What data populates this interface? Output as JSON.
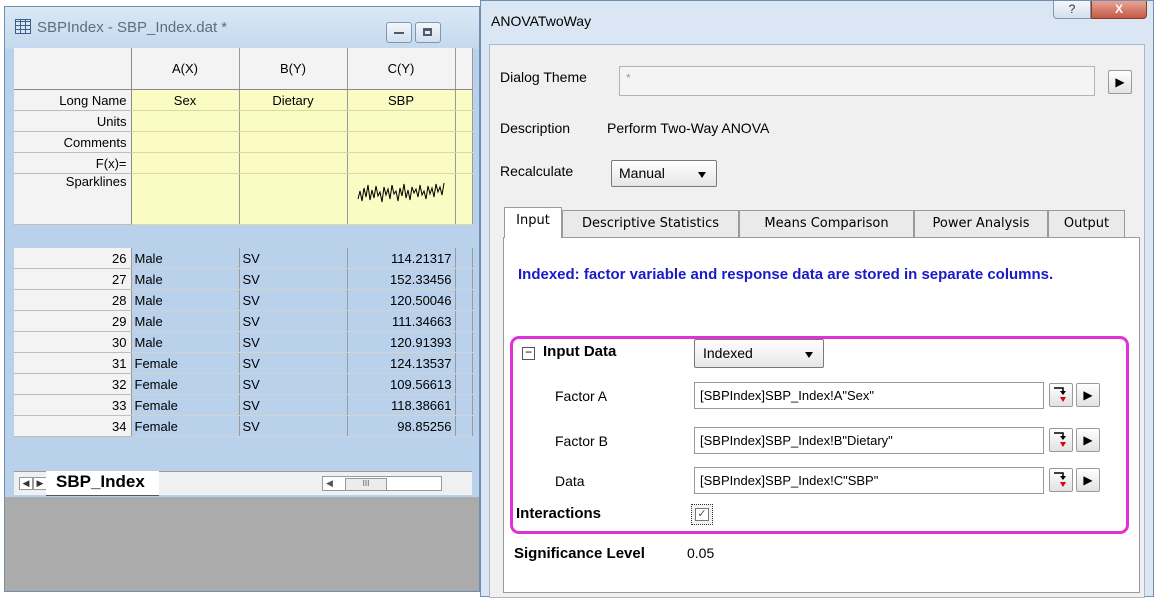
{
  "worksheet": {
    "title": "SBPIndex - SBP_Index.dat *",
    "columns": [
      {
        "letter": "A(X)",
        "long_name": "Sex"
      },
      {
        "letter": "B(Y)",
        "long_name": "Dietary"
      },
      {
        "letter": "C(Y)",
        "long_name": "SBP"
      }
    ],
    "row_labels": {
      "long_name": "Long Name",
      "units": "Units",
      "comments": "Comments",
      "fx": "F(x)=",
      "sparklines": "Sparklines"
    },
    "rows": [
      {
        "n": "26",
        "sex": "Male",
        "diet": "SV",
        "sbp": "114.21317"
      },
      {
        "n": "27",
        "sex": "Male",
        "diet": "SV",
        "sbp": "152.33456"
      },
      {
        "n": "28",
        "sex": "Male",
        "diet": "SV",
        "sbp": "120.50046"
      },
      {
        "n": "29",
        "sex": "Male",
        "diet": "SV",
        "sbp": "111.34663"
      },
      {
        "n": "30",
        "sex": "Male",
        "diet": "SV",
        "sbp": "120.91393"
      },
      {
        "n": "31",
        "sex": "Female",
        "diet": "SV",
        "sbp": "124.13537"
      },
      {
        "n": "32",
        "sex": "Female",
        "diet": "SV",
        "sbp": "109.56613"
      },
      {
        "n": "33",
        "sex": "Female",
        "diet": "SV",
        "sbp": "118.38661"
      },
      {
        "n": "34",
        "sex": "Female",
        "diet": "SV",
        "sbp": "98.85256"
      }
    ],
    "sheet_tab": "SBP_Index",
    "scroll_thumb_glyph": "III"
  },
  "dialog": {
    "title": "ANOVATwoWay",
    "help_glyph": "?",
    "close_glyph": "X",
    "theme_label": "Dialog Theme",
    "theme_value": "*",
    "description_label": "Description",
    "description_value": "Perform Two-Way ANOVA",
    "recalculate_label": "Recalculate",
    "recalculate_value": "Manual",
    "tabs": [
      "Input",
      "Descriptive Statistics",
      "Means Comparison",
      "Power Analysis",
      "Output"
    ],
    "active_tab": "Input",
    "note": "Indexed: factor variable and response data are stored in separate columns.",
    "input_data_label": "Input Data",
    "input_data_mode": "Indexed",
    "factor_a_label": "Factor A",
    "factor_a_value": "[SBPIndex]SBP_Index!A\"Sex\"",
    "factor_b_label": "Factor B",
    "factor_b_value": "[SBPIndex]SBP_Index!B\"Dietary\"",
    "data_label": "Data",
    "data_value": "[SBPIndex]SBP_Index!C\"SBP\"",
    "interactions_label": "Interactions",
    "interactions_checked": true,
    "significance_label": "Significance Level",
    "significance_value": "0.05",
    "highlight_color": "#e031d6",
    "note_color": "#1a1ac8"
  }
}
